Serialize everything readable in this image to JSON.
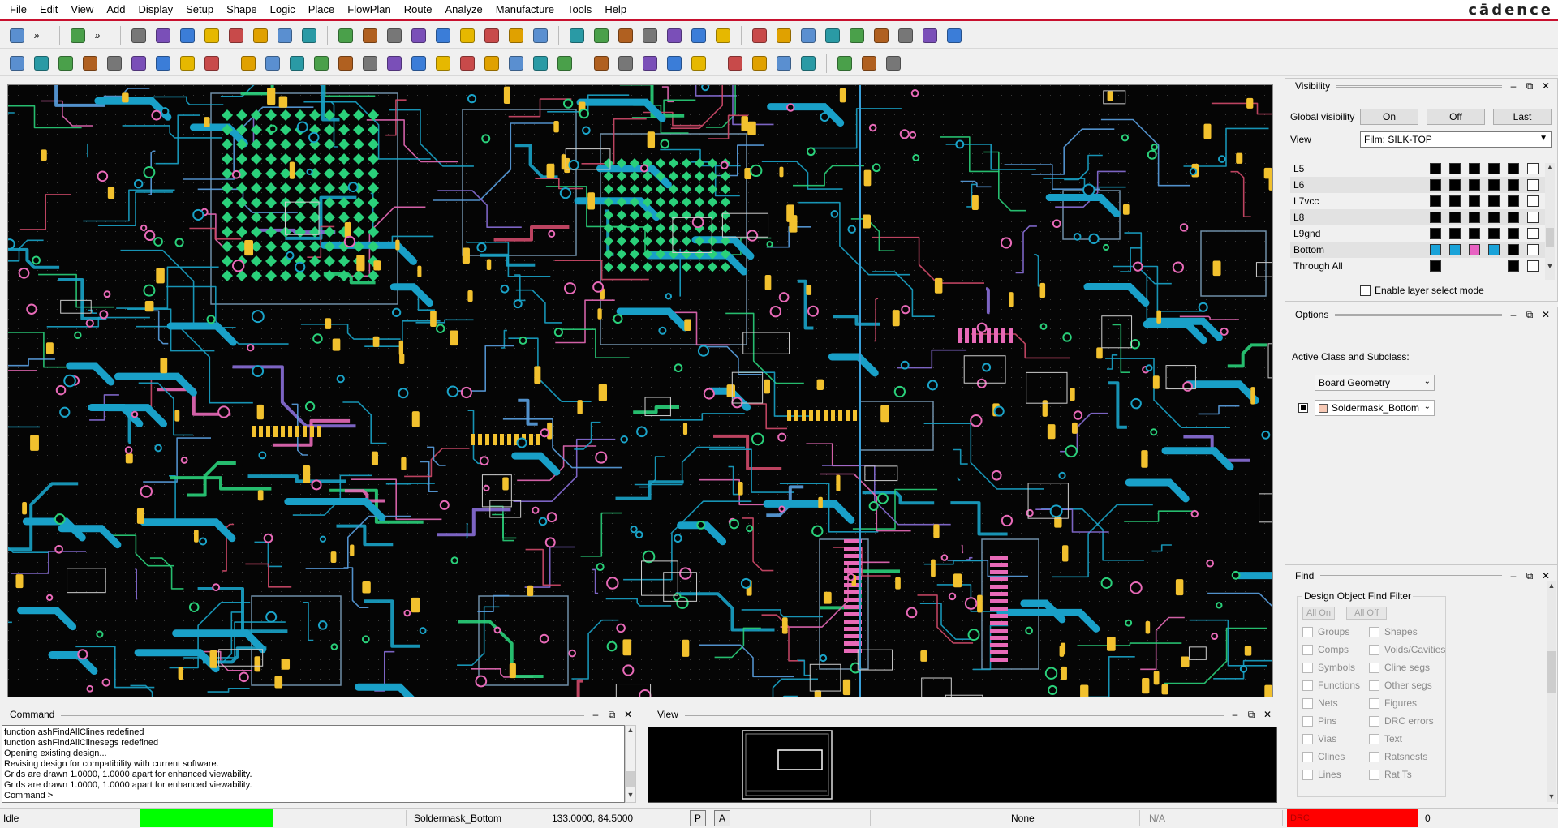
{
  "menu": [
    "File",
    "Edit",
    "View",
    "Add",
    "Display",
    "Setup",
    "Shape",
    "Logic",
    "Place",
    "FlowPlan",
    "Route",
    "Analyze",
    "Manufacture",
    "Tools",
    "Help"
  ],
  "brand": "cādence",
  "visibility": {
    "title": "Visibility",
    "global_label": "Global visibility",
    "btn_on": "On",
    "btn_off": "Off",
    "btn_last": "Last",
    "view_label": "View",
    "view_value": "Film: SILK-TOP",
    "layers": [
      {
        "name": "L5",
        "swatches": [
          "#000000",
          "#000000",
          "#000000",
          "#000000",
          "#000000",
          "#ffffff"
        ]
      },
      {
        "name": "L6",
        "swatches": [
          "#000000",
          "#000000",
          "#000000",
          "#000000",
          "#000000",
          "#ffffff"
        ]
      },
      {
        "name": "L7vcc",
        "swatches": [
          "#000000",
          "#000000",
          "#000000",
          "#000000",
          "#000000",
          "#ffffff"
        ]
      },
      {
        "name": "L8",
        "swatches": [
          "#000000",
          "#000000",
          "#000000",
          "#000000",
          "#000000",
          "#ffffff"
        ]
      },
      {
        "name": "L9gnd",
        "swatches": [
          "#000000",
          "#000000",
          "#000000",
          "#000000",
          "#000000",
          "#ffffff"
        ]
      },
      {
        "name": "Bottom",
        "swatches": [
          "#1aa3d9",
          "#1aa3d9",
          "#e862c2",
          "#1aa3d9",
          "#000000",
          "#ffffff"
        ]
      },
      {
        "name": "Through All",
        "swatches": [
          "#000000",
          "",
          "",
          "",
          "#000000",
          "#ffffff"
        ]
      }
    ],
    "enable_layer_select": "Enable layer select mode"
  },
  "options": {
    "title": "Options",
    "active_label": "Active Class and Subclass:",
    "class_value": "Board Geometry",
    "subclass_value": "Soldermask_Bottom",
    "subclass_color": "#f7c9b5"
  },
  "find": {
    "title": "Find",
    "group_title": "Design Object Find Filter",
    "all_on": "All On",
    "all_off": "All Off",
    "left_items": [
      "Groups",
      "Comps",
      "Symbols",
      "Functions",
      "Nets",
      "Pins",
      "Vias",
      "Clines",
      "Lines"
    ],
    "right_items": [
      "Shapes",
      "Voids/Cavities",
      "Cline segs",
      "Other segs",
      "Figures",
      "DRC errors",
      "Text",
      "Ratsnests",
      "Rat Ts"
    ]
  },
  "command": {
    "title": "Command",
    "lines": [
      "function ashFindAllClines redefined",
      "function ashFindAllClinesegs redefined",
      "Opening existing design...",
      "Revising design for compatibility with current software.",
      "Grids are drawn 1.0000, 1.0000 apart for enhanced viewability.",
      "Grids are drawn 1.0000, 1.0000 apart for enhanced viewability.",
      "Command >"
    ]
  },
  "view_panel": {
    "title": "View"
  },
  "status": {
    "state": "Idle",
    "state_color": "#00ff00",
    "subclass": "Soldermask_Bottom",
    "coords": "133.0000, 84.5000",
    "btn_p": "P",
    "btn_a": "A",
    "selection": "None",
    "na": "N/A",
    "drc_label": "DRC",
    "drc_color": "#ff0000",
    "drc_count": "0"
  },
  "colors": {
    "canvas_bg": "#050505",
    "trace_cyan": "#1aa3c8",
    "trace_green": "#2ad07a",
    "trace_pink": "#e86ab8",
    "pad_yellow": "#f2c12e",
    "accent_red": "#c8102e"
  }
}
